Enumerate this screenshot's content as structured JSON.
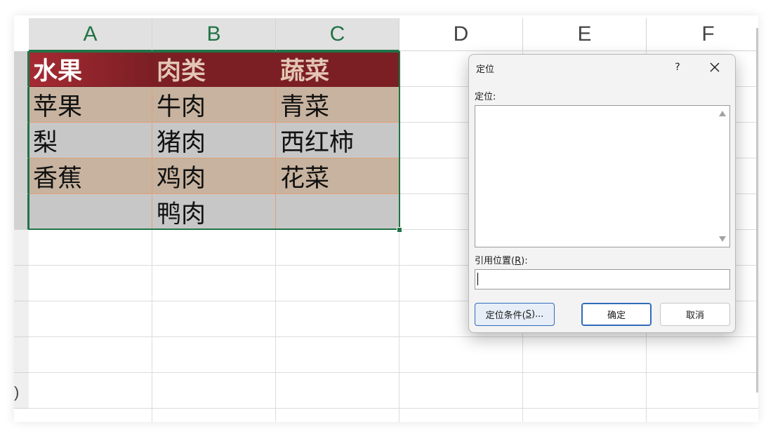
{
  "columns": [
    "A",
    "B",
    "C",
    "D",
    "E",
    "F"
  ],
  "table": {
    "header": [
      "水果",
      "肉类",
      "蔬菜"
    ],
    "rows": [
      [
        "苹果",
        "牛肉",
        "青菜"
      ],
      [
        "梨",
        "猪肉",
        "西红柿"
      ],
      [
        "香蕉",
        "鸡肉",
        "花菜"
      ],
      [
        "",
        "鸭肉",
        ""
      ]
    ]
  },
  "colors": {
    "header_bg": "#7b1f24",
    "header_a_bg": "#a62a33",
    "band_a": "#c7b39f",
    "band_b": "#c7c7c7",
    "selection": "#217346",
    "cell_border": "#e1a07a"
  },
  "partial_row_number": ")",
  "dialog": {
    "title": "定位",
    "help": "?",
    "goto_label": "定位:",
    "reference_label_prefix": "引用位置(",
    "reference_label_key": "R",
    "reference_label_suffix": "):",
    "reference_value": "",
    "special_prefix": "定位条件(",
    "special_key": "S",
    "special_suffix": ")...",
    "ok_label": "确定",
    "cancel_label": "取消"
  }
}
